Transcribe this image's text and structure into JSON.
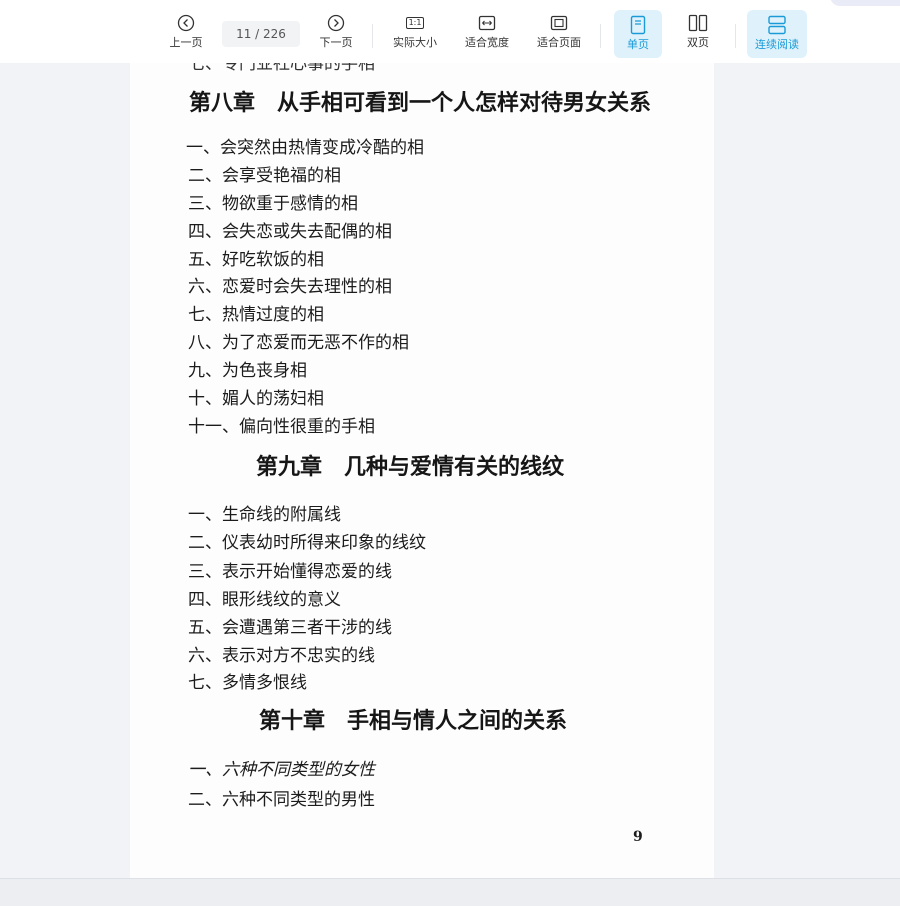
{
  "toolbar": {
    "prev_label": "上一页",
    "page_indicator": "11 / 226",
    "next_label": "下一页",
    "actual_size_label": "实际大小",
    "actual_size_glyph": "1:1",
    "fit_width_label": "适合宽度",
    "fit_page_label": "适合页面",
    "single_page_label": "单页",
    "double_page_label": "双页",
    "continuous_label": "连续阅读",
    "active_color": "#1a9bd7",
    "active_bg": "#dff2fb"
  },
  "document": {
    "cut_line": "七、专门业社心事的手相",
    "chapter8": {
      "title": "第八章　从手相可看到一个人怎样对待男女关系",
      "items": [
        "一、会突然由热情变成冷酷的相",
        "二、会享受艳福的相",
        "三、物欲重于感情的相",
        "四、会失恋或失去配偶的相",
        "五、好吃软饭的相",
        "六、恋爱时会失去理性的相",
        "七、热情过度的相",
        "八、为了恋爱而无恶不作的相",
        "九、为色丧身相",
        "十、媚人的荡妇相",
        "十一、偏向性很重的手相"
      ]
    },
    "chapter9": {
      "title": "第九章　几种与爱情有关的线纹",
      "items": [
        "一、生命线的附属线",
        "二、仪表幼时所得来印象的线纹",
        "三、表示开始懂得恋爱的线",
        "四、眼形线纹的意义",
        "五、会遭遇第三者干涉的线",
        "六、表示对方不忠实的线",
        "七、多情多恨线"
      ]
    },
    "chapter10": {
      "title": "第十章　手相与情人之间的关系",
      "items": [
        "一、六种不同类型的女性",
        "二、六种不同类型的男性"
      ]
    },
    "page_number": "9"
  }
}
